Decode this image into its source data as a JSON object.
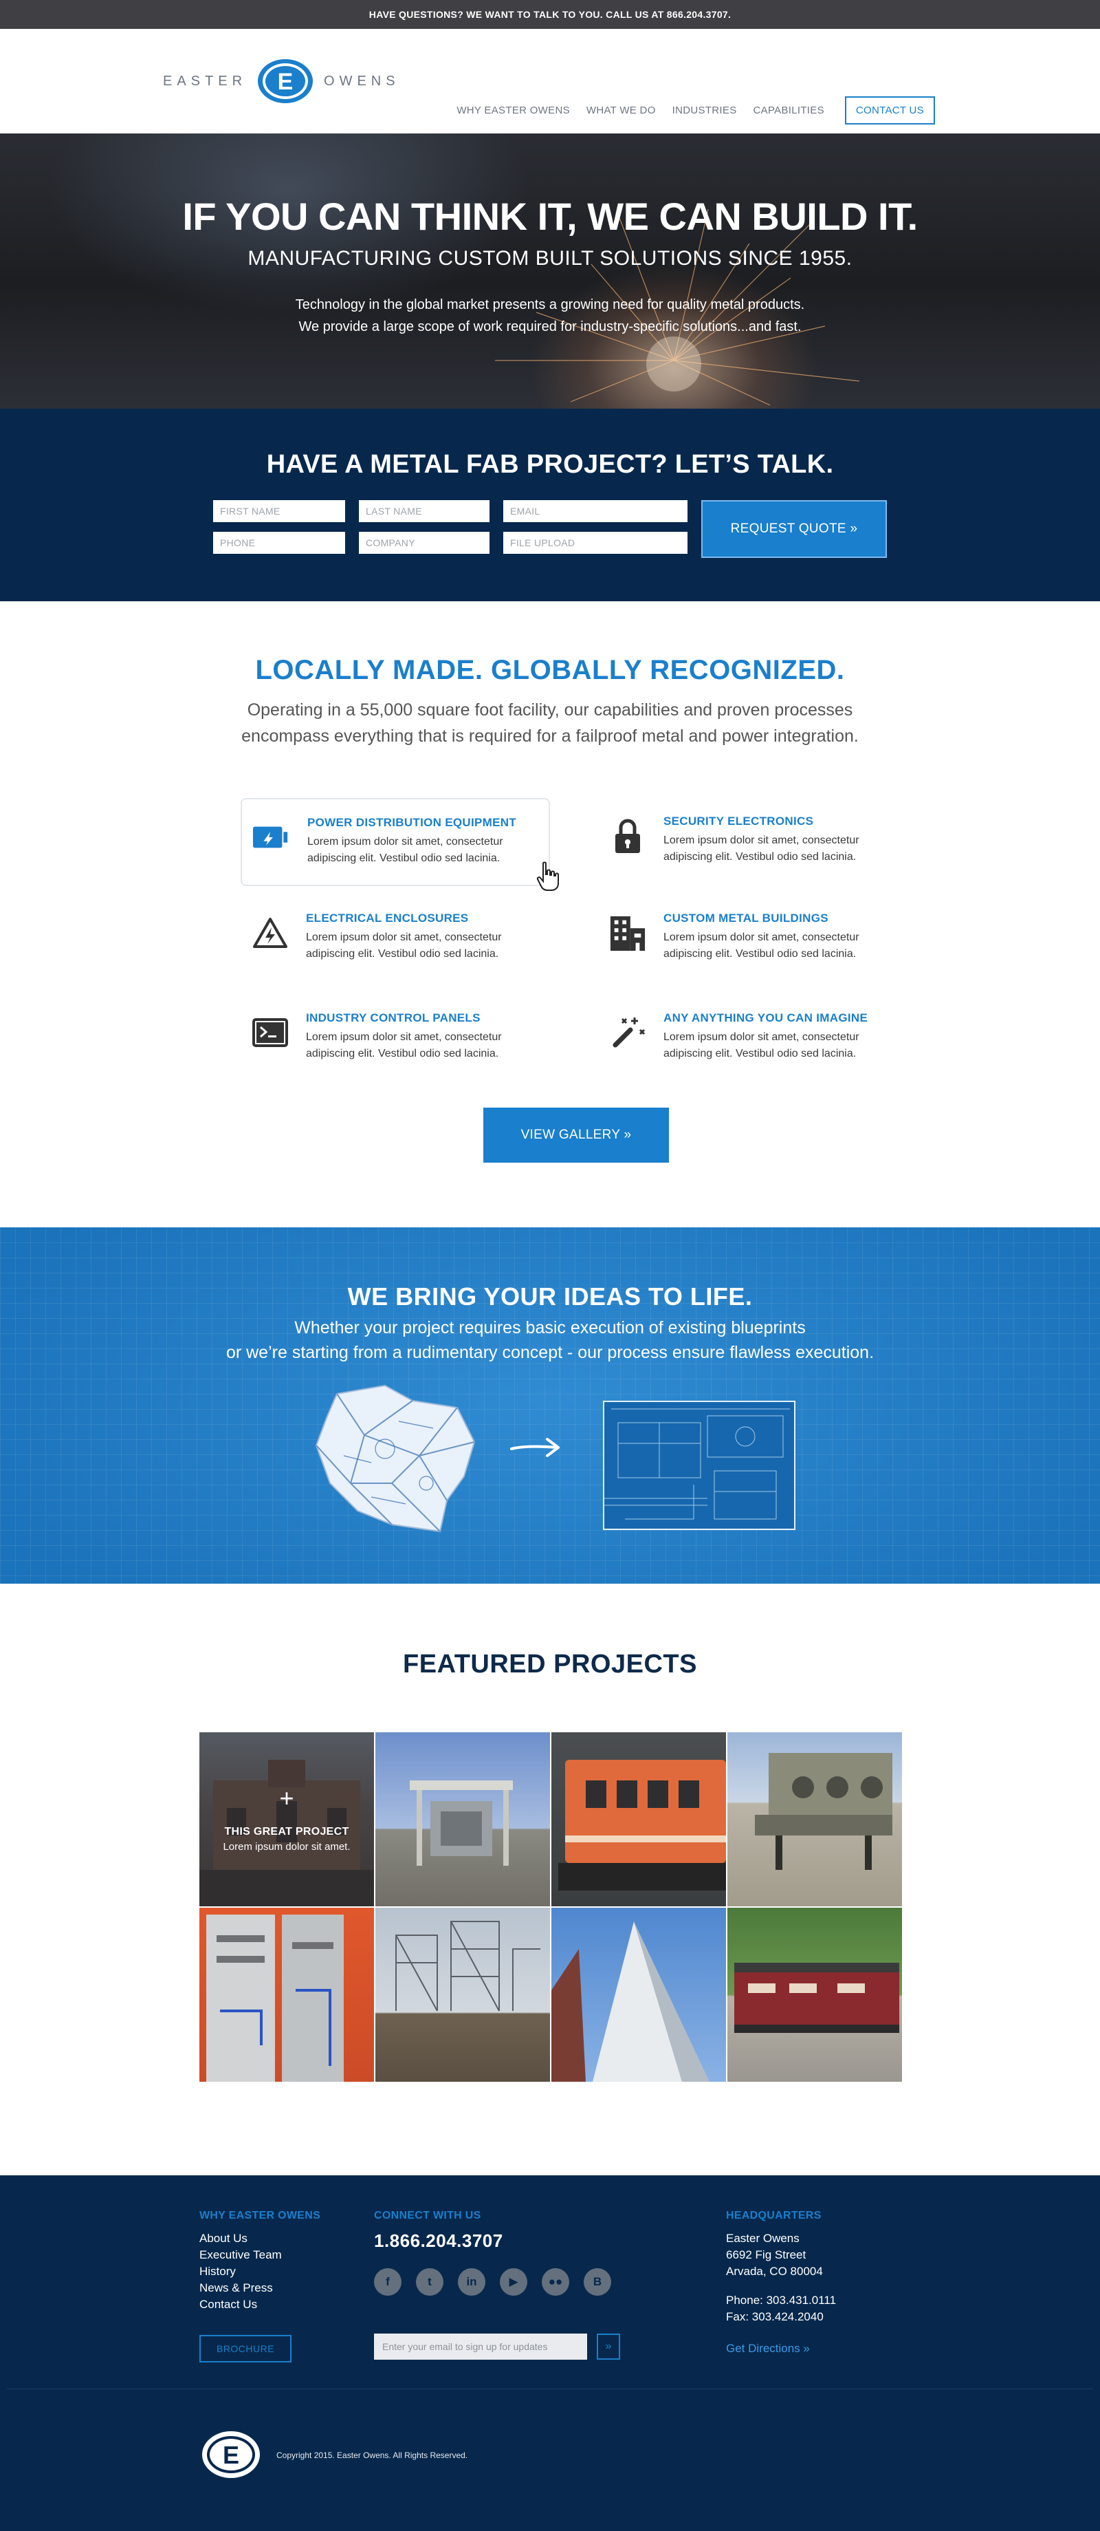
{
  "topbar": {
    "text": "HAVE QUESTIONS? WE WANT TO TALK TO YOU. CALL US AT 866.204.3707."
  },
  "logo": {
    "left_word": "EASTER",
    "right_word": "OWENS",
    "mark_letter": "E"
  },
  "nav": {
    "items": [
      "WHY EASTER OWENS",
      "WHAT WE DO",
      "INDUSTRIES",
      "CAPABILITIES"
    ],
    "contact": "CONTACT US"
  },
  "hero": {
    "title": "IF YOU CAN THINK IT, WE CAN BUILD IT.",
    "subtitle": "MANUFACTURING CUSTOM BUILT SOLUTIONS SINCE 1955.",
    "line1": "Technology in the global market presents a growing need for quality metal products.",
    "line2": "We provide a large scope of work required for industry-specific solutions...and fast."
  },
  "quote": {
    "title": "HAVE A METAL FAB PROJECT? LET’S TALK.",
    "fields": {
      "first_name": "FIRST NAME",
      "last_name": "LAST NAME",
      "email": "EMAIL",
      "phone": "PHONE",
      "company": "COMPANY",
      "file_upload": "FILE UPLOAD"
    },
    "button": "REQUEST QUOTE »"
  },
  "capabilities": {
    "title": "LOCALLY MADE. GLOBALLY RECOGNIZED.",
    "lead1": "Operating in a 55,000 square foot facility, our capabilities and proven processes",
    "lead2": "encompass everything that is required for a failproof metal and power integration.",
    "items": [
      {
        "title": "POWER DISTRIBUTION EQUIPMENT",
        "desc": "Lorem ipsum dolor sit amet, consectetur adipiscing elit. Vestibul odio sed lacinia.",
        "icon": "battery-icon"
      },
      {
        "title": "SECURITY ELECTRONICS",
        "desc": "Lorem ipsum dolor sit amet, consectetur adipiscing elit. Vestibul odio sed lacinia.",
        "icon": "lock-icon"
      },
      {
        "title": "ELECTRICAL ENCLOSURES",
        "desc": "Lorem ipsum dolor sit amet, consectetur adipiscing elit. Vestibul odio sed lacinia.",
        "icon": "high-voltage-icon"
      },
      {
        "title": "CUSTOM METAL BUILDINGS",
        "desc": "Lorem ipsum dolor sit amet, consectetur adipiscing elit. Vestibul odio sed lacinia.",
        "icon": "building-icon"
      },
      {
        "title": "INDUSTRY CONTROL PANELS",
        "desc": "Lorem ipsum dolor sit amet, consectetur adipiscing elit. Vestibul odio sed lacinia.",
        "icon": "terminal-icon"
      },
      {
        "title": "ANY ANYTHING YOU CAN IMAGINE",
        "desc": "Lorem ipsum dolor sit amet, consectetur adipiscing elit. Vestibul odio sed lacinia.",
        "icon": "magic-wand-icon"
      }
    ],
    "gallery_button": "VIEW GALLERY »"
  },
  "ideas": {
    "title": "WE BRING YOUR IDEAS TO LIFE.",
    "line1": "Whether your project requires basic execution of existing blueprints",
    "line2": "or we’re starting from a rudimentary concept - our process ensure flawless execution."
  },
  "featured": {
    "title": "FEATURED PROJECTS",
    "overlay_title": "THIS GREAT PROJECT",
    "overlay_sub": "Lorem ipsum dolor sit amet.",
    "overlay_plus": "+"
  },
  "footer": {
    "why_title": "WHY EASTER OWENS",
    "links": [
      "About Us",
      "Executive Team",
      "History",
      "News & Press",
      "Contact Us"
    ],
    "brochure": "BROCHURE",
    "connect_title": "CONNECT WITH US",
    "phone": "1.866.204.3707",
    "social": [
      {
        "icon": "facebook-icon",
        "glyph": "f"
      },
      {
        "icon": "twitter-icon",
        "glyph": "t"
      },
      {
        "icon": "linkedin-icon",
        "glyph": "in"
      },
      {
        "icon": "youtube-icon",
        "glyph": "▶"
      },
      {
        "icon": "flickr-icon",
        "glyph": "●●"
      },
      {
        "icon": "blogger-icon",
        "glyph": "B"
      }
    ],
    "signup_placeholder": "Enter your email to sign up for updates",
    "signup_button": "»",
    "hq_title": "HEADQUARTERS",
    "hq_lines": [
      "Easter Owens",
      "6692 Fig Street",
      "Arvada, CO 80004"
    ],
    "phone_line": "Phone: 303.431.0111",
    "fax_line": "Fax: 303.424.2040",
    "directions": "Get Directions »",
    "copyright": "Copyright 2015. Easter Owens. All Rights Reserved."
  },
  "colors": {
    "brand_blue": "#1a7fcc",
    "navy": "#07284c",
    "topbar": "#3f3f44"
  }
}
